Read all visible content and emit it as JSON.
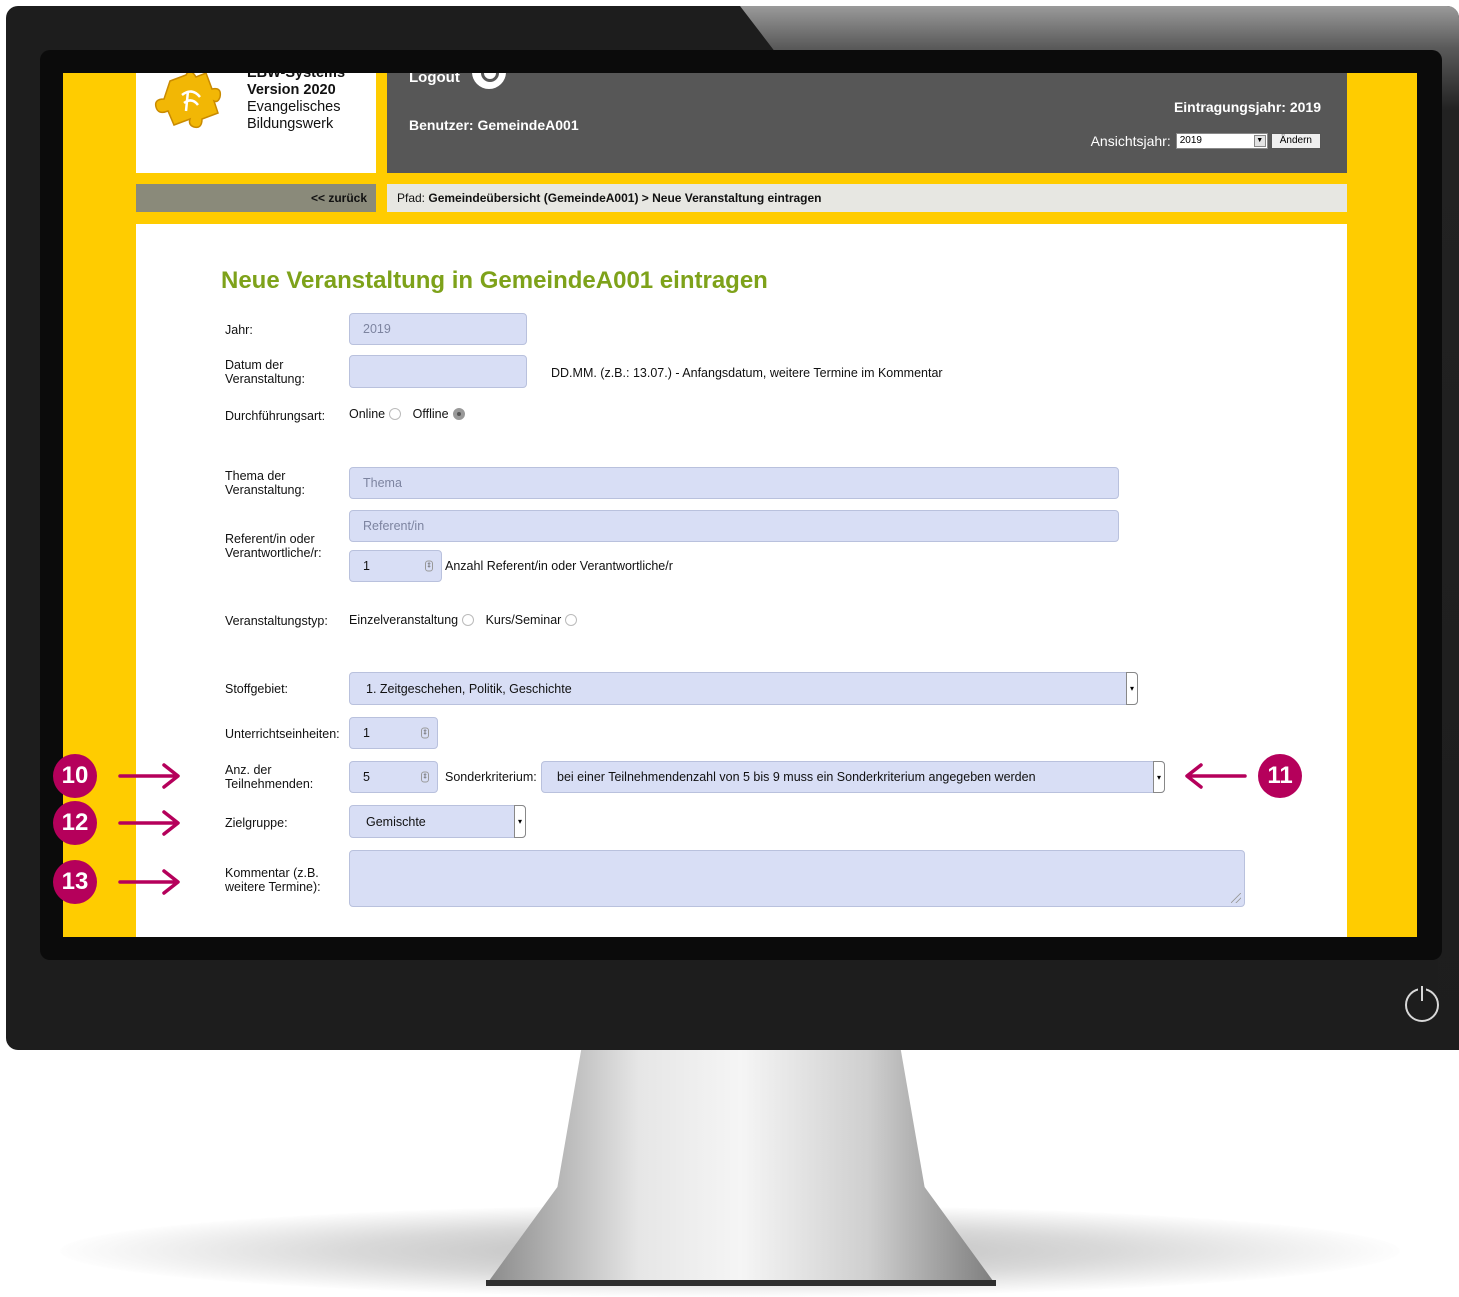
{
  "header": {
    "logo_line1": "EBW-Systems",
    "logo_line2": "Version 2020",
    "logo_line3": "Evangelisches",
    "logo_line4": "Bildungswerk",
    "logout_label": "Logout",
    "user_label": "Benutzer: GemeindeA001",
    "entry_year": "Eintragungsjahr: 2019",
    "view_year_label": "Ansichtsjahr:",
    "view_year_value": "2019",
    "change_button": "Ändern"
  },
  "nav": {
    "back_label": "<< zurück",
    "path_prefix": "Pfad:",
    "path_value": "Gemeindeübersicht (GemeindeA001) > Neue Veranstaltung eintragen"
  },
  "form": {
    "title": "Neue Veranstaltung in GemeindeA001 eintragen",
    "jahr_label": "Jahr:",
    "jahr_value": "2019",
    "datum_label_1": "Datum der",
    "datum_label_2": "Veranstaltung:",
    "datum_hint": "DD.MM. (z.B.: 13.07.) - Anfangsdatum, weitere Termine im Kommentar",
    "art_label": "Durchführungsart:",
    "art_online": "Online",
    "art_offline": "Offline",
    "thema_label_1": "Thema der",
    "thema_label_2": "Veranstaltung:",
    "thema_placeholder": "Thema",
    "referent_label_1": "Referent/in oder",
    "referent_label_2": "Verantwortliche/r:",
    "referent_placeholder": "Referent/in",
    "referent_count": "1",
    "referent_count_hint": "Anzahl Referent/in oder Verantwortliche/r",
    "typ_label": "Veranstaltungstyp:",
    "typ_einzel": "Einzelveranstaltung",
    "typ_kurs": "Kurs/Seminar",
    "stoff_label": "Stoffgebiet:",
    "stoff_value": "1. Zeitgeschehen, Politik, Geschichte",
    "ue_label": "Unterrichtseinheiten:",
    "ue_value": "1",
    "tn_label_1": "Anz. der",
    "tn_label_2": "Teilnehmenden:",
    "tn_value": "5",
    "sonder_label": "Sonderkriterium:",
    "sonder_value": "bei einer Teilnehmendenzahl von 5 bis 9 muss ein Sonderkriterium angegeben werden",
    "ziel_label": "Zielgruppe:",
    "ziel_value": "Gemischte",
    "kommentar_label_1": "Kommentar (z.B.",
    "kommentar_label_2": "weitere Termine):"
  },
  "annotations": {
    "badge_10": "10",
    "badge_11": "11",
    "badge_12": "12",
    "badge_13": "13",
    "color": "#b5005b"
  },
  "colors": {
    "accent_yellow": "#ffcc00",
    "title_green": "#7ea21a",
    "header_dark": "#575757",
    "field_bg": "#d8def5"
  }
}
